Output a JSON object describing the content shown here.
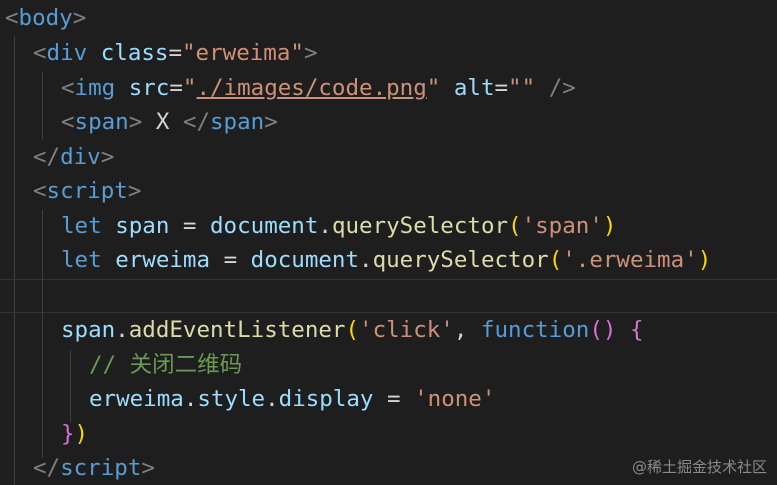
{
  "code": {
    "l1": {
      "open": "<",
      "tag": "body",
      "close": ">"
    },
    "l2": {
      "open": "<",
      "tag": "div",
      "attr": "class",
      "eq": "=",
      "val": "\"erweima\"",
      "close": ">"
    },
    "l3": {
      "open": "<",
      "tag": "img",
      "attr1": "src",
      "eq1": "=",
      "q1": "\"",
      "src": "./images/code.png",
      "q2": "\"",
      "attr2": "alt",
      "eq2": "=",
      "val2": "\"\"",
      "close": "/>"
    },
    "l4": {
      "open": "<",
      "tag": "span",
      "gt": ">",
      "text": "X",
      "lt": "</",
      "tag2": "span",
      "close": ">"
    },
    "l5": {
      "open": "</",
      "tag": "div",
      "close": ">"
    },
    "l6": {
      "open": "<",
      "tag": "script",
      "close": ">"
    },
    "l7": {
      "kw": "let",
      "var": "span",
      "op": "=",
      "obj": "document",
      "dot": ".",
      "method": "querySelector",
      "p1": "(",
      "arg": "'span'",
      "p2": ")"
    },
    "l8": {
      "kw": "let",
      "var": "erweima",
      "op": "=",
      "obj": "document",
      "dot": ".",
      "method": "querySelector",
      "p1": "(",
      "arg": "'.erweima'",
      "p2": ")"
    },
    "l10": {
      "obj": "span",
      "dot": ".",
      "method": "addEventListener",
      "p1": "(",
      "arg": "'click'",
      "comma": ",",
      "kw": "function",
      "p2": "()",
      "brace": "{"
    },
    "l11": {
      "comment": "// 关闭二维码"
    },
    "l12": {
      "obj": "erweima",
      "dot1": ".",
      "prop1": "style",
      "dot2": ".",
      "prop2": "display",
      "op": "=",
      "val": "'none'"
    },
    "l13": {
      "brace": "}",
      "paren": ")"
    },
    "l14": {
      "open": "</",
      "tag": "script",
      "close": ">"
    }
  },
  "watermark": "@稀土掘金技术社区"
}
